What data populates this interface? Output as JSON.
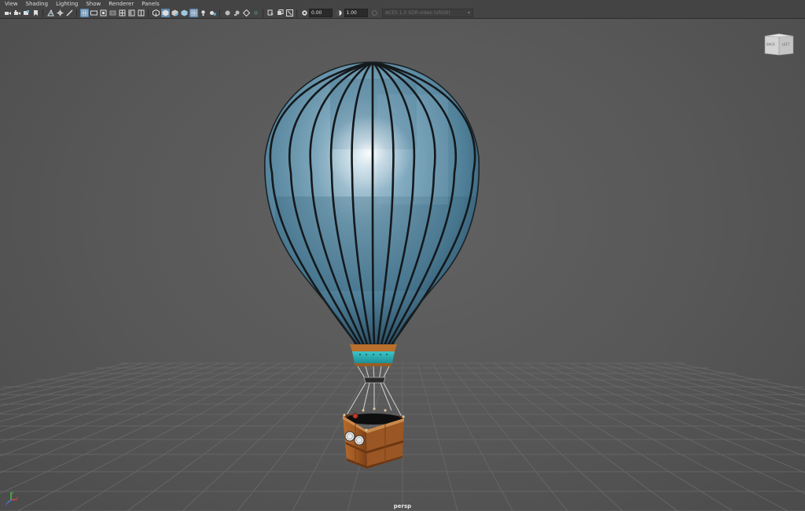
{
  "menu": [
    "View",
    "Shading",
    "Lighting",
    "Show",
    "Renderer",
    "Panels"
  ],
  "toolbar": {
    "exposure_value": "0.00",
    "gamma_value": "1.00",
    "color_space": "ACES 1.0 SDR-video (sRGB)",
    "icons": [
      "select-camera-icon",
      "camera-attributes-icon",
      "bookmark-icon",
      "image-plane-icon",
      "grid-icon",
      "film-gate-icon",
      "resolution-gate-icon",
      "gate-mask-icon",
      "field-chart-icon",
      "safe-action-icon",
      "safe-title-icon",
      "wireframe-icon",
      "smooth-shade-icon",
      "default-material-icon",
      "wireframe-on-shaded-icon",
      "xray-icon",
      "xray-joints-icon",
      "xray-components-icon",
      "all-lights-icon",
      "shadows-icon",
      "ambient-occlusion-icon",
      "motion-blur-icon",
      "multisample-aa-icon",
      "isolate-select-icon",
      "xray-toggle-icon",
      "frame-selection-icon",
      "texture-icon",
      "exposure-icon",
      "gamma-icon",
      "color-management-icon"
    ]
  },
  "viewcube": {
    "face_back": "BACK",
    "face_left": "LEFT"
  },
  "viewport": {
    "camera": "persp"
  },
  "colors": {
    "ui_background": "#444444",
    "viewport_background": "#5a5a5a",
    "balloon_fabric": "#5f8fa6",
    "balloon_ribs": "#151a1d",
    "basket_wood": "#9a5624",
    "band_teal": "#2bb3b8",
    "highlight": "#5d87ad"
  }
}
